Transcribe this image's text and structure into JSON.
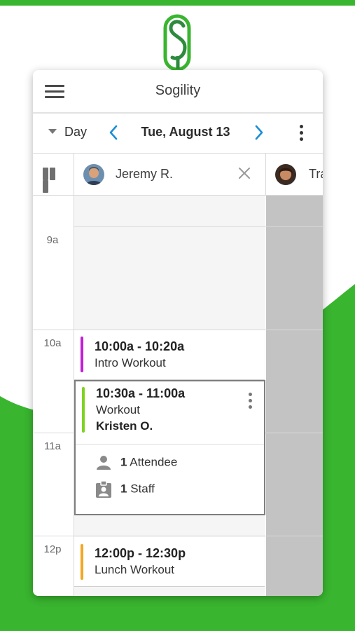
{
  "app": {
    "title": "Sogility"
  },
  "toolbar": {
    "view_label": "Day",
    "date": "Tue, August 13"
  },
  "staff": [
    {
      "name": "Jeremy R."
    },
    {
      "name": "Tra"
    }
  ],
  "time_labels": [
    "9a",
    "10a",
    "11a",
    "12p"
  ],
  "events": [
    {
      "time": "10:00a - 10:20a",
      "name": "Intro Workout",
      "color": "#c21fd6"
    },
    {
      "time": "10:30a - 11:00a",
      "name": "Workout",
      "client": "Kristen O.",
      "color": "#7ed321",
      "attendees_count": "1",
      "attendees_label": "Attendee",
      "staff_count": "1",
      "staff_label": "Staff"
    },
    {
      "time": "12:00p - 12:30p",
      "name": "Lunch Workout",
      "color": "#f5a623"
    }
  ],
  "colors": {
    "brand_green": "#39b52f",
    "accent_blue": "#1a8fd6"
  },
  "icons": [
    "menu-icon",
    "caret-down-icon",
    "chevron-left-icon",
    "chevron-right-icon",
    "more-vert-icon",
    "columns-icon",
    "close-icon",
    "person-icon",
    "badge-icon"
  ]
}
